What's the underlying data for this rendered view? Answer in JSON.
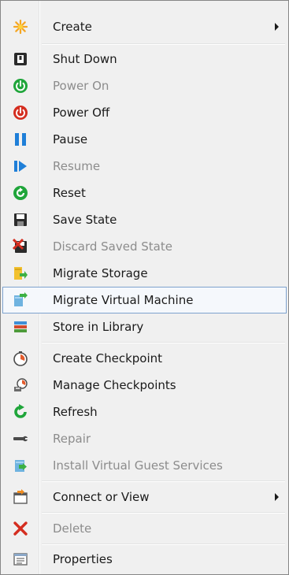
{
  "menu": {
    "items": [
      {
        "label": "Create",
        "icon": "create-icon",
        "enabled": true,
        "submenu": true
      },
      {
        "label": "Shut Down",
        "icon": "shut-down-icon",
        "enabled": true
      },
      {
        "label": "Power On",
        "icon": "power-on-icon",
        "enabled": false
      },
      {
        "label": "Power Off",
        "icon": "power-off-icon",
        "enabled": true
      },
      {
        "label": "Pause",
        "icon": "pause-icon",
        "enabled": true
      },
      {
        "label": "Resume",
        "icon": "resume-icon",
        "enabled": false
      },
      {
        "label": "Reset",
        "icon": "reset-icon",
        "enabled": true
      },
      {
        "label": "Save State",
        "icon": "save-state-icon",
        "enabled": true
      },
      {
        "label": "Discard Saved State",
        "icon": "discard-saved-state-icon",
        "enabled": false
      },
      {
        "label": "Migrate Storage",
        "icon": "migrate-storage-icon",
        "enabled": true
      },
      {
        "label": "Migrate Virtual Machine",
        "icon": "migrate-vm-icon",
        "enabled": true,
        "highlighted": true
      },
      {
        "label": "Store in Library",
        "icon": "store-in-library-icon",
        "enabled": true
      },
      {
        "label": "Create Checkpoint",
        "icon": "create-checkpoint-icon",
        "enabled": true
      },
      {
        "label": "Manage Checkpoints",
        "icon": "manage-checkpoints-icon",
        "enabled": true
      },
      {
        "label": "Refresh",
        "icon": "refresh-icon",
        "enabled": true
      },
      {
        "label": "Repair",
        "icon": "repair-icon",
        "enabled": false
      },
      {
        "label": "Install Virtual Guest Services",
        "icon": "install-guest-services-icon",
        "enabled": false
      },
      {
        "label": "Connect or View",
        "icon": "connect-or-view-icon",
        "enabled": true,
        "submenu": true
      },
      {
        "label": "Delete",
        "icon": "delete-icon",
        "enabled": false
      },
      {
        "label": "Properties",
        "icon": "properties-icon",
        "enabled": true
      }
    ]
  },
  "colors": {
    "highlight_border": "#7da2ce",
    "highlight_fill": "#f5f8fc",
    "disabled_text": "#8c8c8c",
    "text": "#1a1a1a"
  }
}
